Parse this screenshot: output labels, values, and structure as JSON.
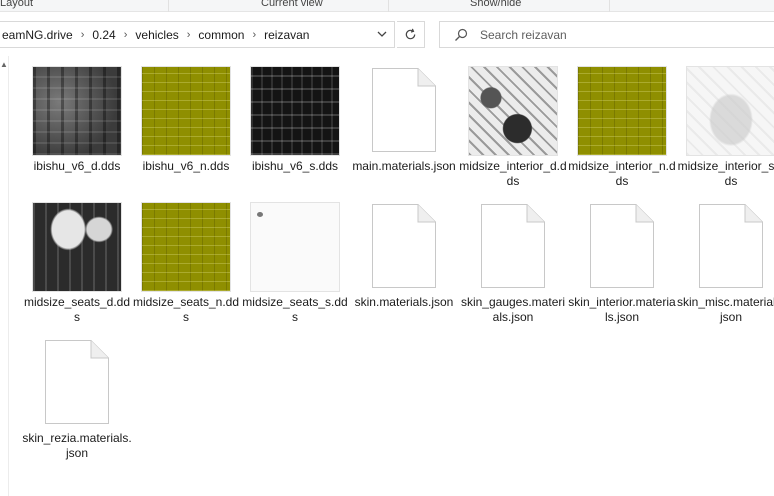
{
  "ribbon": {
    "labels": [
      "Layout",
      "Current view",
      "Show/hide"
    ]
  },
  "address": {
    "crumbs": [
      "eamNG.drive",
      "0.24",
      "vehicles",
      "common",
      "reizavan"
    ]
  },
  "search": {
    "placeholder": "Search reizavan"
  },
  "files": [
    {
      "name": "ibishu_v6_d.dds",
      "kind": "texture",
      "look": "dark"
    },
    {
      "name": "ibishu_v6_n.dds",
      "kind": "texture",
      "look": "olive"
    },
    {
      "name": "ibishu_v6_s.dds",
      "kind": "texture",
      "look": "black"
    },
    {
      "name": "main.materials.json",
      "kind": "document"
    },
    {
      "name": "midsize_interior_d.dds",
      "kind": "texture",
      "look": "interior"
    },
    {
      "name": "midsize_interior_n.dds",
      "kind": "texture",
      "look": "olive"
    },
    {
      "name": "midsize_interior_s.dds",
      "kind": "texture",
      "look": "light"
    },
    {
      "name": "midsize_seats_d.dds",
      "kind": "texture",
      "look": "seats"
    },
    {
      "name": "midsize_seats_n.dds",
      "kind": "texture",
      "look": "olive"
    },
    {
      "name": "midsize_seats_s.dds",
      "kind": "texture",
      "look": "white"
    },
    {
      "name": "skin.materials.json",
      "kind": "document"
    },
    {
      "name": "skin_gauges.materials.json",
      "kind": "document"
    },
    {
      "name": "skin_interior.materials.json",
      "kind": "document"
    },
    {
      "name": "skin_misc.materials.json",
      "kind": "document"
    },
    {
      "name": "skin_rezia.materials.json",
      "kind": "document"
    }
  ]
}
